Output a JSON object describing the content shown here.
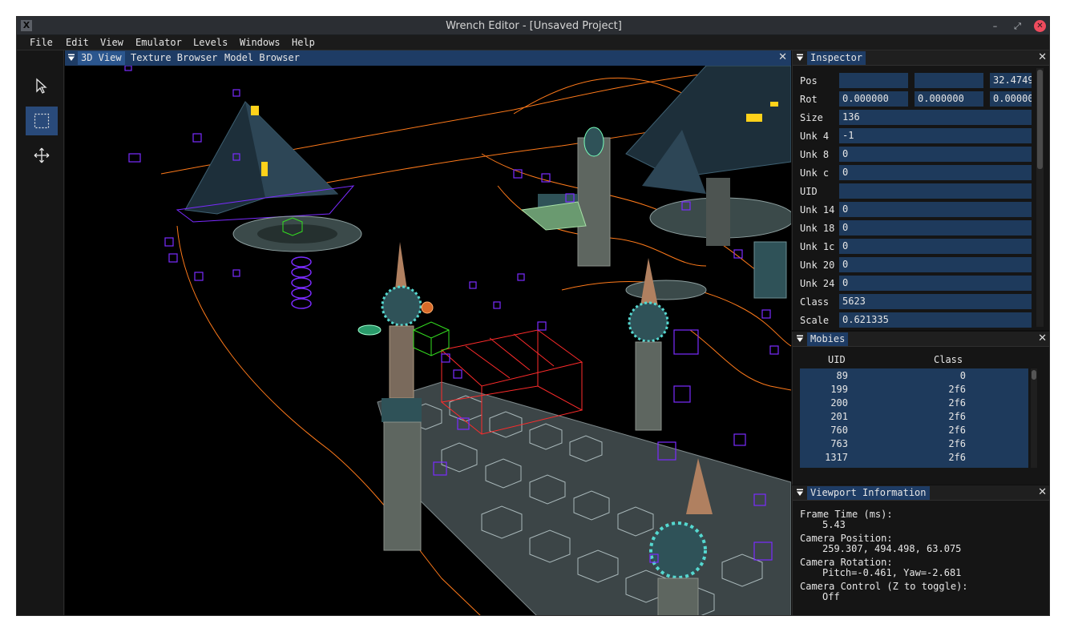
{
  "window": {
    "title": "Wrench Editor - [Unsaved Project]",
    "app_icon_glyph": "X",
    "min_glyph": "–",
    "max_glyph": "⤢",
    "close_glyph": "✕"
  },
  "menu": [
    "File",
    "Edit",
    "View",
    "Emulator",
    "Levels",
    "Windows",
    "Help"
  ],
  "toolbox": {
    "tools": [
      {
        "name": "select-pointer-icon",
        "active": false
      },
      {
        "name": "box-select-icon",
        "active": true
      },
      {
        "name": "move-icon",
        "active": false
      }
    ]
  },
  "view_tabs": {
    "tabs": [
      "3D View",
      "Texture Browser",
      "Model Browser"
    ],
    "active": "3D View",
    "close_glyph": "✕"
  },
  "inspector": {
    "title": "Inspector",
    "close_glyph": "✕",
    "rows": [
      {
        "label": "Pos",
        "values": [
          "",
          "",
          "32.4749"
        ]
      },
      {
        "label": "Rot",
        "values": [
          "0.000000",
          "0.000000",
          "0.00000"
        ]
      },
      {
        "label": "Size",
        "values": [
          "136"
        ]
      },
      {
        "label": "Unk 4",
        "values": [
          "-1"
        ]
      },
      {
        "label": "Unk 8",
        "values": [
          "0"
        ]
      },
      {
        "label": "Unk c",
        "values": [
          "0"
        ]
      },
      {
        "label": "UID",
        "values": [
          ""
        ]
      },
      {
        "label": "Unk 14",
        "values": [
          "0"
        ]
      },
      {
        "label": "Unk 18",
        "values": [
          "0"
        ]
      },
      {
        "label": "Unk 1c",
        "values": [
          "0"
        ]
      },
      {
        "label": "Unk 20",
        "values": [
          "0"
        ]
      },
      {
        "label": "Unk 24",
        "values": [
          "0"
        ]
      },
      {
        "label": "Class",
        "values": [
          "5623"
        ]
      },
      {
        "label": "Scale",
        "values": [
          "0.621335"
        ]
      }
    ]
  },
  "mobies": {
    "title": "Mobies",
    "close_glyph": "✕",
    "columns": [
      "UID",
      "Class"
    ],
    "rows": [
      {
        "uid": "89",
        "class": "0"
      },
      {
        "uid": "199",
        "class": "2f6"
      },
      {
        "uid": "200",
        "class": "2f6"
      },
      {
        "uid": "201",
        "class": "2f6"
      },
      {
        "uid": "760",
        "class": "2f6"
      },
      {
        "uid": "763",
        "class": "2f6"
      },
      {
        "uid": "1317",
        "class": "2f6"
      }
    ]
  },
  "viewport_info": {
    "title": "Viewport Information",
    "close_glyph": "✕",
    "frame_time_label": "Frame Time (ms):",
    "frame_time_value": "5.43",
    "camera_position_label": "Camera Position:",
    "camera_position_value": "259.307, 494.498, 63.075",
    "camera_rotation_label": "Camera Rotation:",
    "camera_rotation_value": "Pitch=-0.461, Yaw=-2.681",
    "camera_control_label": "Camera Control (Z to toggle):",
    "camera_control_value": "Off"
  },
  "colors": {
    "accent": "#1e3c65",
    "active_tab": "#2b568e",
    "field_bg": "#1e3a5c",
    "close_button": "#ee4b5d",
    "wire_purple": "#7a2bff",
    "wire_orange": "#ff7a1a",
    "wire_red": "#ff2b2b",
    "wire_green": "#34e020"
  }
}
